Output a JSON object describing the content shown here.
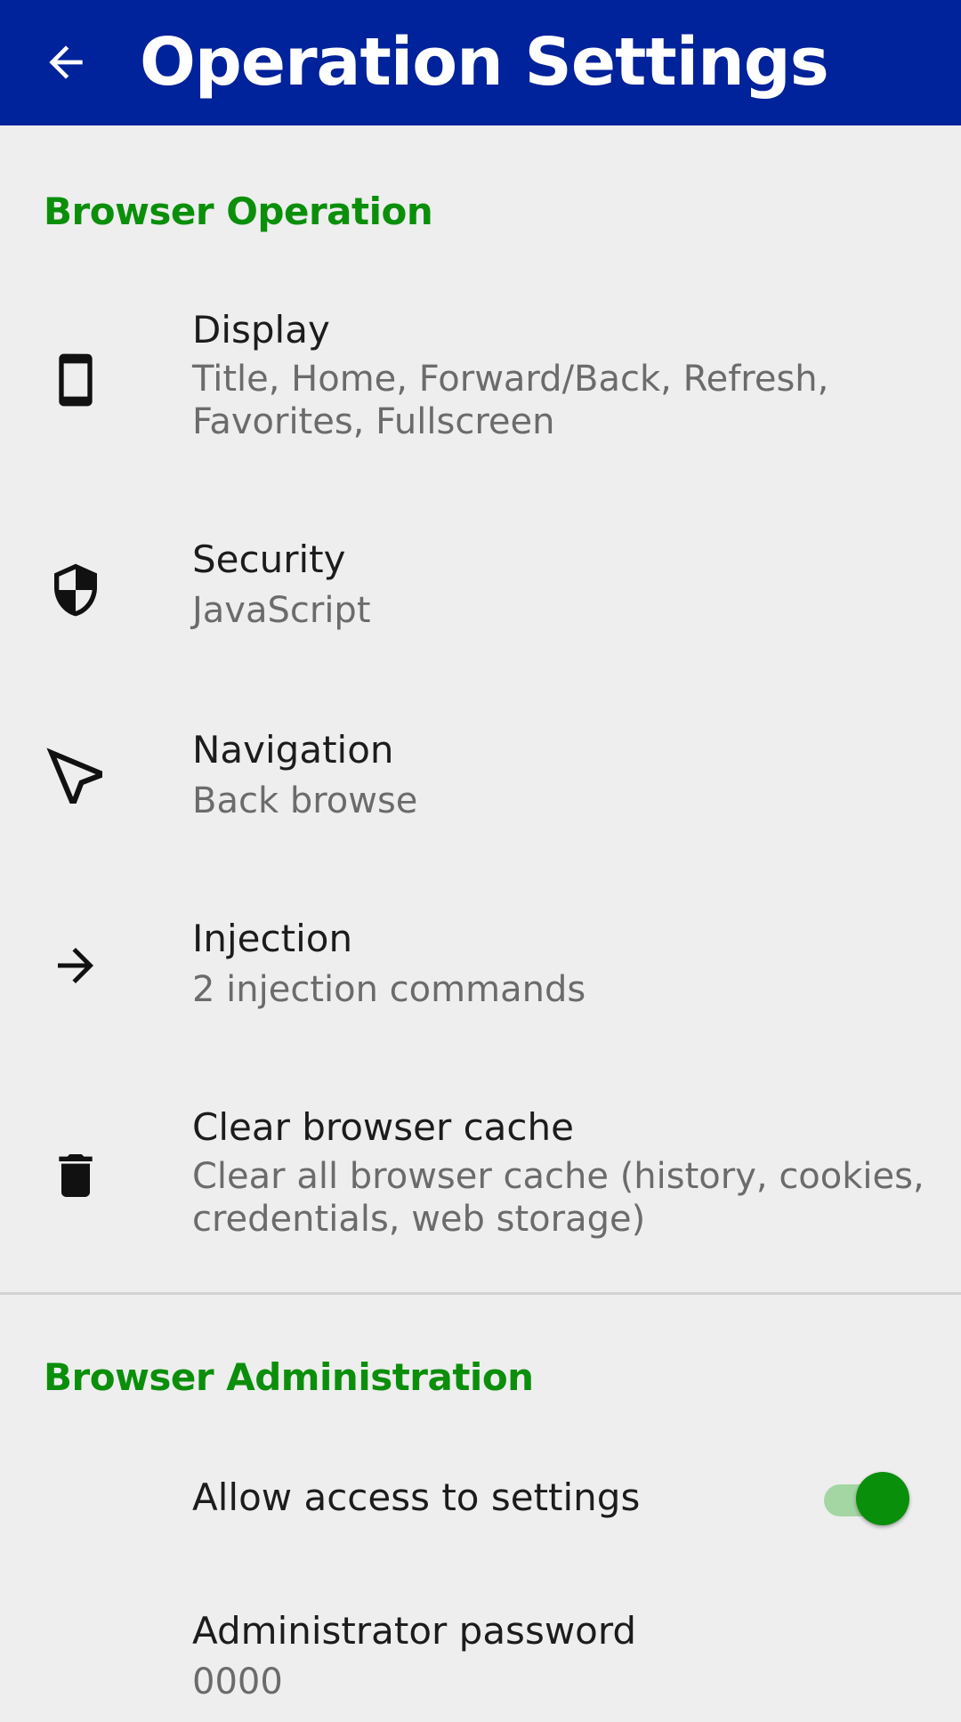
{
  "header": {
    "title": "Operation Settings",
    "back_icon": "arrow-left-icon",
    "background_color": "#00229a"
  },
  "sections": [
    {
      "title": "Browser Operation",
      "color": "#0b8f0b",
      "items": [
        {
          "icon": "smartphone-icon",
          "title": "Display",
          "summary": "Title, Home, Forward/Back, Refresh, Favorites, Fullscreen"
        },
        {
          "icon": "shield-icon",
          "title": "Security",
          "summary": "JavaScript"
        },
        {
          "icon": "navigation-icon",
          "title": "Navigation",
          "summary": "Back browse"
        },
        {
          "icon": "arrow-right-icon",
          "title": "Injection",
          "summary": "2 injection commands"
        },
        {
          "icon": "trash-icon",
          "title": "Clear browser cache",
          "summary": "Clear all browser cache (history, cookies, credentials, web storage)"
        }
      ]
    },
    {
      "title": "Browser Administration",
      "color": "#0b8f0b",
      "items": [
        {
          "title": "Allow access to settings",
          "toggle_on": true
        },
        {
          "title": "Administrator password",
          "summary": "0000"
        }
      ]
    }
  ]
}
